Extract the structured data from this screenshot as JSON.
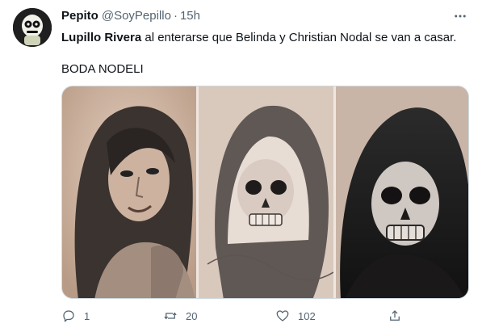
{
  "author": {
    "display_name": "Pepito",
    "handle": "@SoyPepillo",
    "separator": "·",
    "time": "15h"
  },
  "tweet": {
    "mention_name": "Lupillo Rivera",
    "line1_rest": " al enterarse que Belinda y Christian Nodal se van a casar.",
    "line2": "BODA NODELI"
  },
  "media": {
    "panels": [
      "woman-portrait-tattoo",
      "sketch-skull-hood-tattoo",
      "shaded-skull-hood-tattoo"
    ]
  },
  "actions": {
    "reply_count": "1",
    "retweet_count": "20",
    "like_count": "102"
  },
  "icons": {
    "more": "more-horizontal-icon",
    "reply": "reply-icon",
    "retweet": "retweet-icon",
    "like": "heart-icon",
    "share": "share-icon"
  },
  "colors": {
    "text": "#0f1419",
    "secondary": "#536471",
    "border": "#cfd9de"
  }
}
